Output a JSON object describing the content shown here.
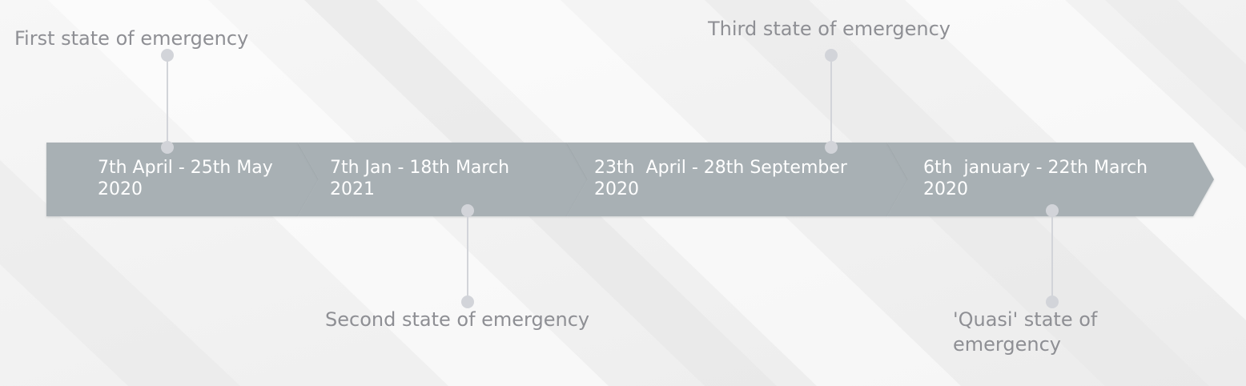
{
  "colors": {
    "background": "#f3f3f3",
    "arrow_fill": "#a8b0b4",
    "connector": "#d2d4d9",
    "label_text": "#8e8f94",
    "segment_text": "#ffffff"
  },
  "timeline": {
    "segments": [
      {
        "line1": "7th April - 25th May",
        "line2": "2020"
      },
      {
        "line1": "7th Jan - 18th March",
        "line2": "2021"
      },
      {
        "line1": "23th  April - 28th September",
        "line2": "2020"
      },
      {
        "line1": "6th  january - 22th March",
        "line2": "2020"
      }
    ],
    "milestones": [
      {
        "label": "First state of emergency",
        "side": "top"
      },
      {
        "label": "Second state of emergency",
        "side": "bottom"
      },
      {
        "label": "Third state of emergency",
        "side": "top"
      },
      {
        "label": "'Quasi' state of emergency",
        "side": "bottom"
      }
    ]
  }
}
